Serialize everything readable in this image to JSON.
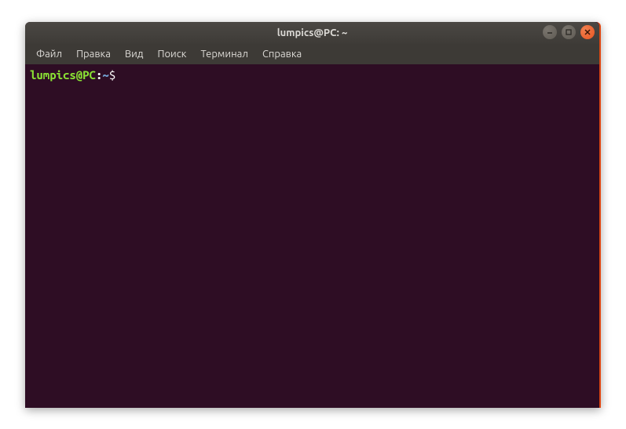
{
  "window": {
    "title": "lumpics@PC: ~"
  },
  "menubar": {
    "items": [
      "Файл",
      "Правка",
      "Вид",
      "Поиск",
      "Терминал",
      "Справка"
    ]
  },
  "terminal": {
    "prompt_user": "lumpics@PC",
    "prompt_colon": ":",
    "prompt_path": "~",
    "prompt_symbol": "$",
    "input_value": ""
  }
}
